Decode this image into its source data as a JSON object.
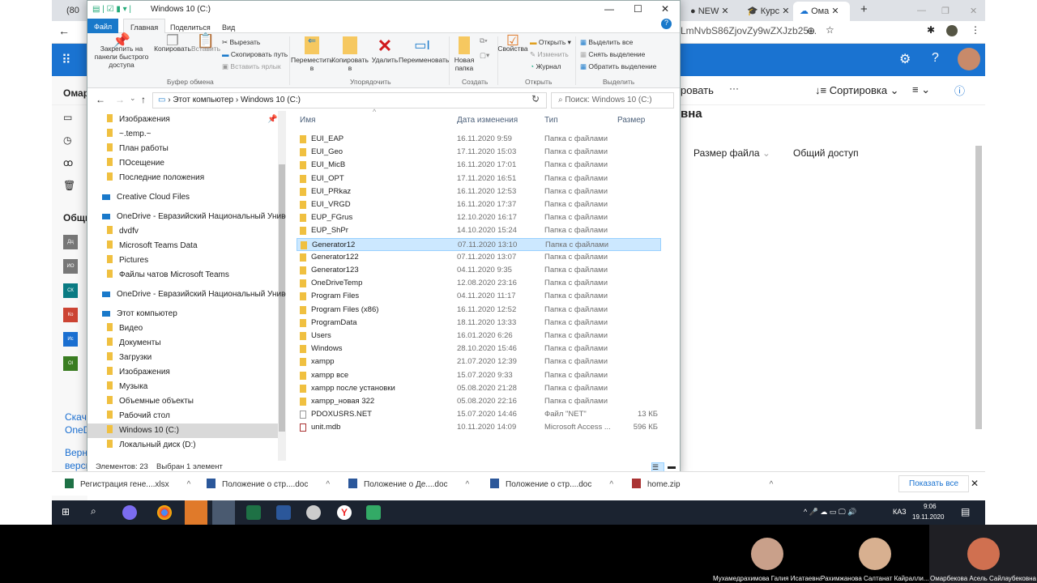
{
  "browser": {
    "tabs": [
      {
        "label": "(80"
      },
      {
        "label": "NEW"
      },
      {
        "label": "Курс"
      },
      {
        "label": "Ома"
      }
    ],
    "url": "JLmNvbS86ZjovZy9wZXJzb25...",
    "colors": {
      "brand": "#1a73d1"
    }
  },
  "onedrive": {
    "user_short": "Омар",
    "shared_heading": "Общи",
    "toolbar_partial": "ровать",
    "more": "···",
    "sort_label": "Сортировка",
    "title_partial": "вна",
    "col_size": "Размер файла",
    "col_sharing": "Общий доступ",
    "nav_tiles": [
      "Дц",
      "ИО",
      "СК",
      "Ко",
      "Ис",
      "Ol"
    ],
    "download_link_partial": [
      "Скача",
      "OneD"
    ],
    "return_link_partial": [
      "Верн",
      "верси"
    ]
  },
  "explorer": {
    "title": "Windows 10 (C:)",
    "ribbon_tabs": [
      "Файл",
      "Главная",
      "Поделиться",
      "Вид"
    ],
    "clipboard": {
      "pin": "Закрепить на панели быстрого доступа",
      "copy": "Копировать",
      "paste": "Вставить",
      "cut": "Вырезать",
      "copy_path": "Скопировать путь",
      "paste_shortcut": "Вставить ярлык",
      "group": "Буфер обмена"
    },
    "organize": {
      "move": "Переместить в",
      "copy": "Копировать в",
      "delete": "Удалить",
      "rename": "Переименовать",
      "group": "Упорядочить"
    },
    "create": {
      "new_folder": "Новая папка",
      "group": "Создать"
    },
    "open": {
      "properties": "Свойства",
      "open": "Открыть",
      "edit": "Изменить",
      "history": "Журнал",
      "group": "Открыть"
    },
    "select": {
      "all": "Выделить все",
      "none": "Снять выделение",
      "invert": "Обратить выделение",
      "group": "Выделить"
    },
    "breadcrumb": [
      "Этот компьютер",
      "Windows 10 (C:)"
    ],
    "search_placeholder": "Поиск: Windows 10 (C:)",
    "nav": [
      {
        "label": "Изображения",
        "indent": 2
      },
      {
        "label": "~.temp.~",
        "indent": 2
      },
      {
        "label": "План работы",
        "indent": 2
      },
      {
        "label": "ПОсещение",
        "indent": 2
      },
      {
        "label": "Последние положения",
        "indent": 2
      },
      {
        "label": "Creative Cloud Files",
        "indent": 1
      },
      {
        "label": "OneDrive - Евразийский Национальный Универ",
        "indent": 1
      },
      {
        "label": "dvdfv",
        "indent": 2
      },
      {
        "label": "Microsoft Teams Data",
        "indent": 2
      },
      {
        "label": "Pictures",
        "indent": 2
      },
      {
        "label": "Файлы чатов Microsoft Teams",
        "indent": 2
      },
      {
        "label": "OneDrive - Евразийский Национальный Универ",
        "indent": 1
      },
      {
        "label": "Этот компьютер",
        "indent": 1
      },
      {
        "label": "Видео",
        "indent": 2
      },
      {
        "label": "Документы",
        "indent": 2
      },
      {
        "label": "Загрузки",
        "indent": 2
      },
      {
        "label": "Изображения",
        "indent": 2
      },
      {
        "label": "Музыка",
        "indent": 2
      },
      {
        "label": "Объемные объекты",
        "indent": 2
      },
      {
        "label": "Рабочий стол",
        "indent": 2
      },
      {
        "label": "Windows 10 (C:)",
        "indent": 2,
        "selected": true
      },
      {
        "label": "Локальный диск (D:)",
        "indent": 2
      }
    ],
    "columns": [
      "Имя",
      "Дата изменения",
      "Тип",
      "Размер"
    ],
    "files": [
      {
        "name": "EUI_EAP",
        "date": "16.11.2020 9:59",
        "type": "Папка с файлами",
        "size": ""
      },
      {
        "name": "EUI_Geo",
        "date": "17.11.2020 15:03",
        "type": "Папка с файлами",
        "size": ""
      },
      {
        "name": "EUI_MicB",
        "date": "16.11.2020 17:01",
        "type": "Папка с файлами",
        "size": ""
      },
      {
        "name": "EUI_OPT",
        "date": "17.11.2020 16:51",
        "type": "Папка с файлами",
        "size": ""
      },
      {
        "name": "EUI_PRkaz",
        "date": "16.11.2020 12:53",
        "type": "Папка с файлами",
        "size": ""
      },
      {
        "name": "EUI_VRGD",
        "date": "16.11.2020 17:37",
        "type": "Папка с файлами",
        "size": ""
      },
      {
        "name": "EUP_FGrus",
        "date": "12.10.2020 16:17",
        "type": "Папка с файлами",
        "size": ""
      },
      {
        "name": "EUP_ShPr",
        "date": "14.10.2020 15:24",
        "type": "Папка с файлами",
        "size": ""
      },
      {
        "name": "Generator12",
        "date": "07.11.2020 13:10",
        "type": "Папка с файлами",
        "size": "",
        "selected": true
      },
      {
        "name": "Generator122",
        "date": "07.11.2020 13:07",
        "type": "Папка с файлами",
        "size": ""
      },
      {
        "name": "Generator123",
        "date": "04.11.2020 9:35",
        "type": "Папка с файлами",
        "size": ""
      },
      {
        "name": "OneDriveTemp",
        "date": "12.08.2020 23:16",
        "type": "Папка с файлами",
        "size": ""
      },
      {
        "name": "Program Files",
        "date": "04.11.2020 11:17",
        "type": "Папка с файлами",
        "size": ""
      },
      {
        "name": "Program Files (x86)",
        "date": "16.11.2020 12:52",
        "type": "Папка с файлами",
        "size": ""
      },
      {
        "name": "ProgramData",
        "date": "18.11.2020 13:33",
        "type": "Папка с файлами",
        "size": ""
      },
      {
        "name": "Users",
        "date": "16.01.2020 6:26",
        "type": "Папка с файлами",
        "size": ""
      },
      {
        "name": "Windows",
        "date": "28.10.2020 15:46",
        "type": "Папка с файлами",
        "size": ""
      },
      {
        "name": "xampp",
        "date": "21.07.2020 12:39",
        "type": "Папка с файлами",
        "size": ""
      },
      {
        "name": "xampp все",
        "date": "15.07.2020 9:33",
        "type": "Папка с файлами",
        "size": ""
      },
      {
        "name": "xampp после установки",
        "date": "05.08.2020 21:28",
        "type": "Папка с файлами",
        "size": ""
      },
      {
        "name": "xampp_новая 322",
        "date": "05.08.2020 22:16",
        "type": "Папка с файлами",
        "size": ""
      },
      {
        "name": "PDOXUSRS.NET",
        "date": "15.07.2020 14:46",
        "type": "Файл \"NET\"",
        "size": "13 КБ",
        "kind": "doc"
      },
      {
        "name": "unit.mdb",
        "date": "10.11.2020 14:09",
        "type": "Microsoft Access ...",
        "size": "596 КБ",
        "kind": "mdb"
      }
    ],
    "status_count": "Элементов: 23",
    "status_selected": "Выбран 1 элемент"
  },
  "downloads": {
    "items": [
      "Регистрация гене....xlsx",
      "Положение о стр....doc",
      "Положение о Де....doc",
      "Положение о стр....doc",
      "home.zip"
    ],
    "show_all": "Показать все"
  },
  "taskbar": {
    "lang": "КАЗ",
    "time": "9:06",
    "date": "19.11.2020"
  },
  "participants": [
    "Мухамедрахимова Галия Исатаевна",
    "Рахимжанова Салтанат Кайралли...",
    "Омарбекова Асель Сайлаубековна"
  ]
}
